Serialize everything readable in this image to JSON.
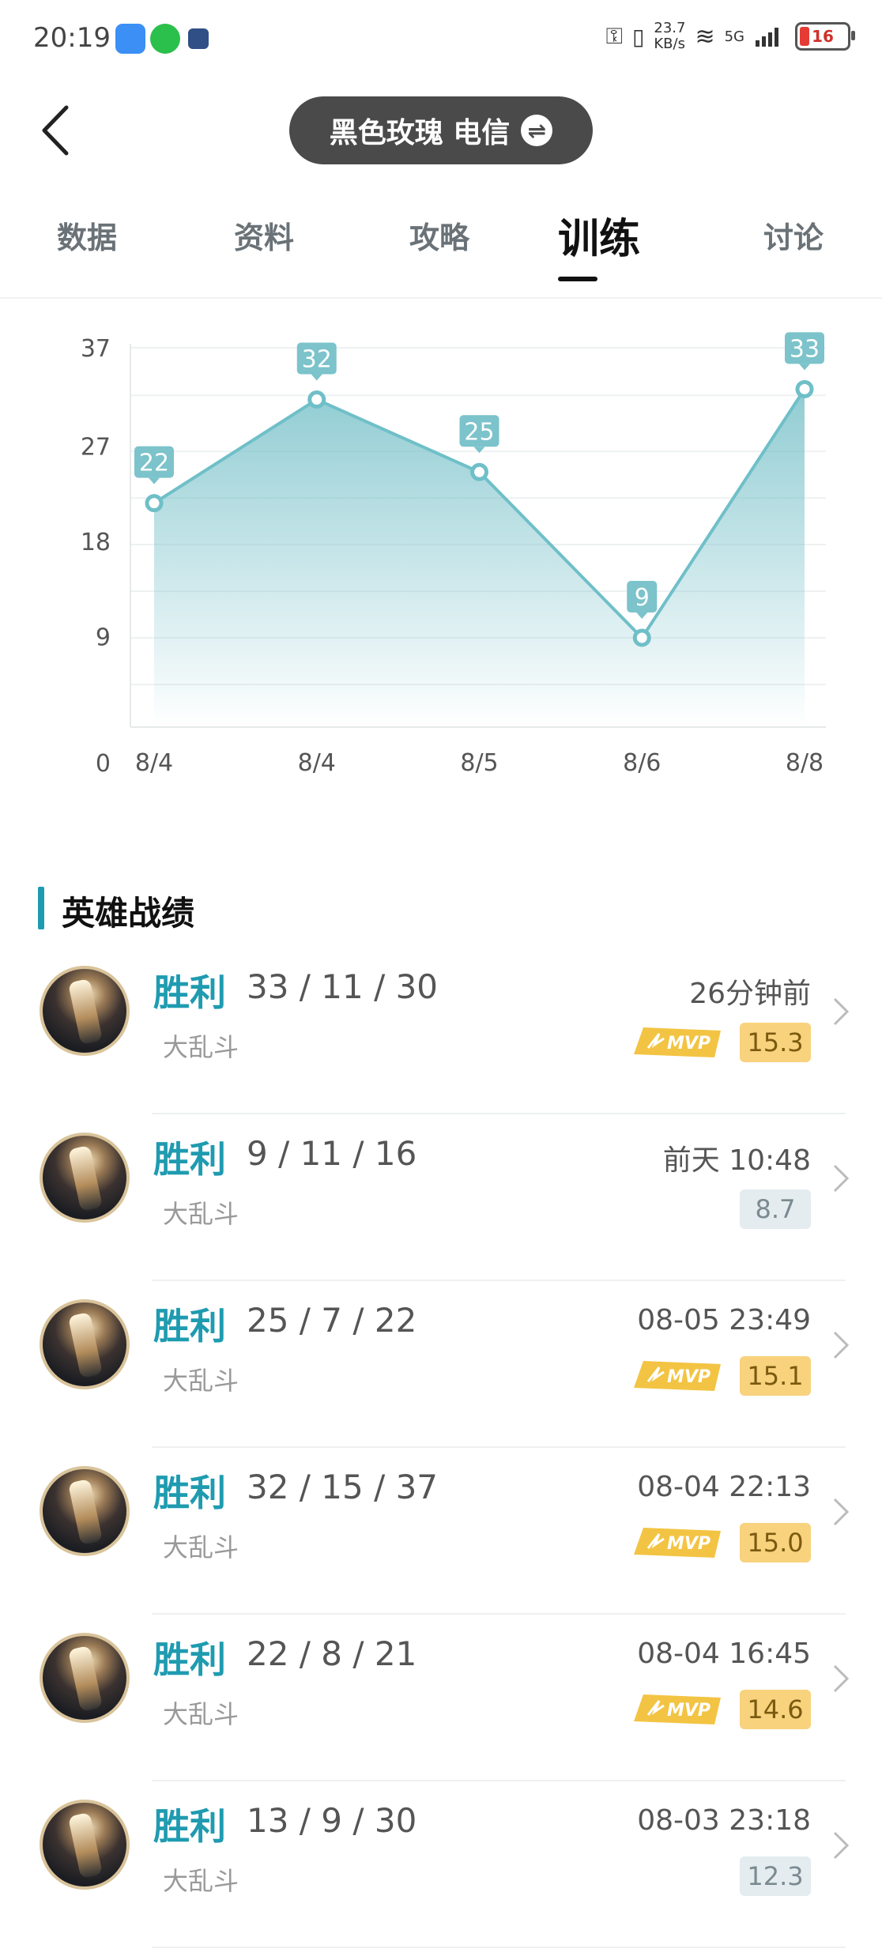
{
  "status_bar": {
    "time": "20:19",
    "net_speed_value": "23.7",
    "net_speed_unit": "KB/s",
    "network_type": "5G",
    "battery": "16"
  },
  "header": {
    "title": "黑色玫瑰 电信",
    "swap_icon": "⇌"
  },
  "tabs": [
    {
      "label": "数据"
    },
    {
      "label": "资料"
    },
    {
      "label": "攻略"
    },
    {
      "label": "训练"
    },
    {
      "label": "讨论"
    }
  ],
  "active_tab": "训练",
  "chart_data": {
    "type": "line",
    "categories": [
      "8/4",
      "8/4",
      "8/5",
      "8/6",
      "8/8"
    ],
    "values": [
      22,
      32,
      25,
      9,
      33
    ],
    "y_ticks": [
      "37",
      "27",
      "18",
      "9",
      "0"
    ],
    "ylim": [
      0,
      37
    ],
    "area_fill": true,
    "color": "#6fbfc8"
  },
  "section": {
    "title": "英雄战绩"
  },
  "records": [
    {
      "result": "胜利",
      "kda": "33 / 11 / 30",
      "mode": "大乱斗",
      "time": "26分钟前",
      "score": "15.3",
      "mvp": true
    },
    {
      "result": "胜利",
      "kda": "9 / 11 / 16",
      "mode": "大乱斗",
      "time": "前天 10:48",
      "score": "8.7",
      "mvp": false
    },
    {
      "result": "胜利",
      "kda": "25 / 7 / 22",
      "mode": "大乱斗",
      "time": "08-05 23:49",
      "score": "15.1",
      "mvp": true
    },
    {
      "result": "胜利",
      "kda": "32 / 15 / 37",
      "mode": "大乱斗",
      "time": "08-04 22:13",
      "score": "15.0",
      "mvp": true
    },
    {
      "result": "胜利",
      "kda": "22 / 8 / 21",
      "mode": "大乱斗",
      "time": "08-04 16:45",
      "score": "14.6",
      "mvp": true
    },
    {
      "result": "胜利",
      "kda": "13 / 9 / 30",
      "mode": "大乱斗",
      "time": "08-03 23:18",
      "score": "12.3",
      "mvp": false
    }
  ],
  "mvp_label": "MVP",
  "colors": {
    "accent": "#1f9bb0",
    "mvp_gold": "#f0c040"
  }
}
